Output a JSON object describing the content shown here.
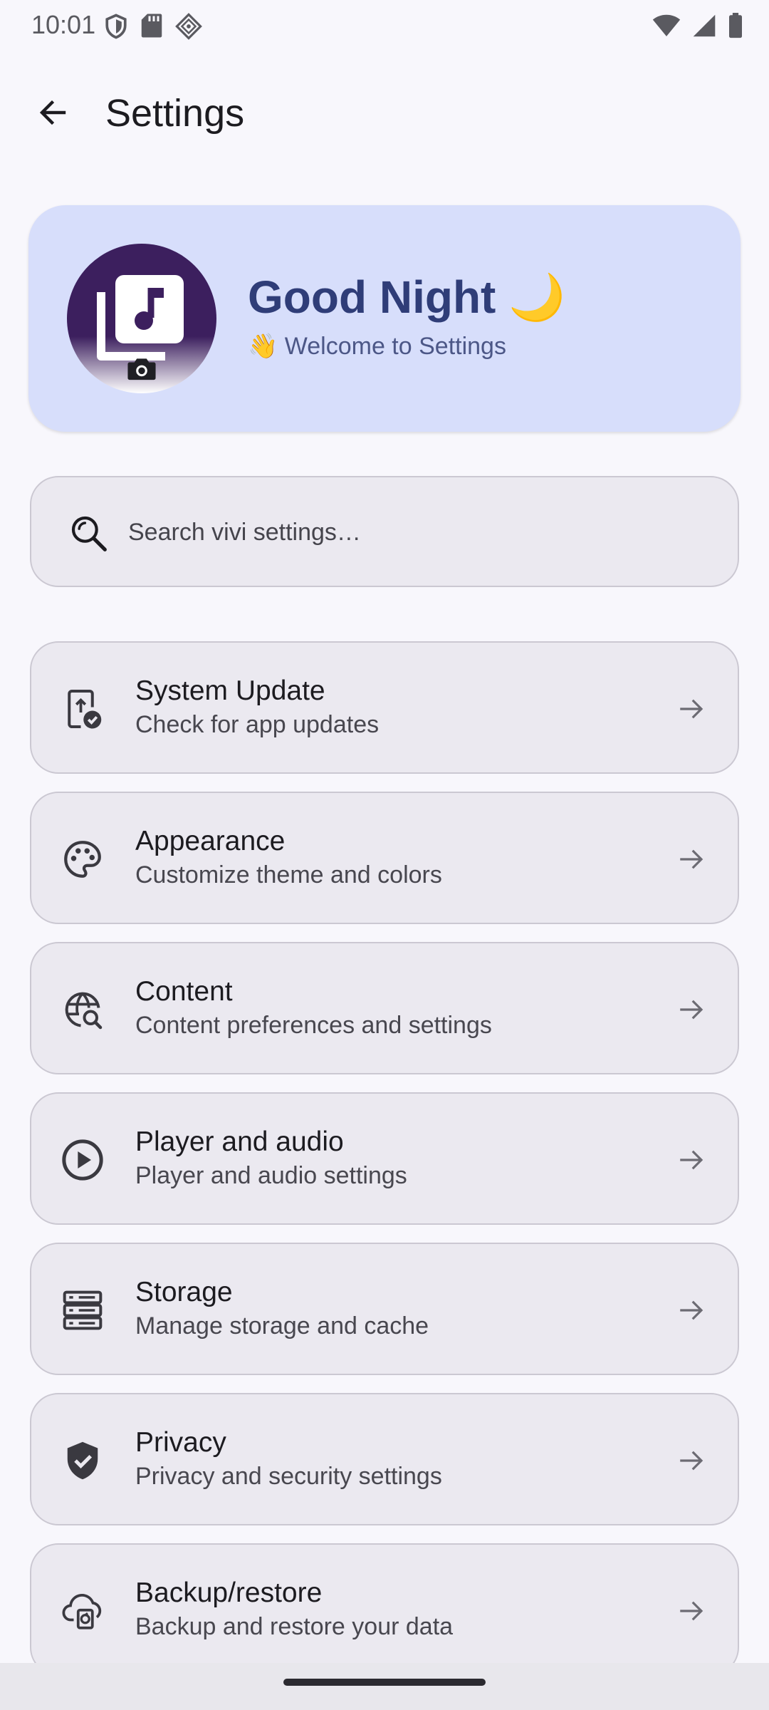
{
  "status_bar": {
    "time": "10:01",
    "icons": [
      "shield-icon",
      "sd-card-icon",
      "vpn-diamond-icon",
      "wifi-icon",
      "signal-icon",
      "battery-icon"
    ]
  },
  "app_bar": {
    "back_icon": "arrow-back-icon",
    "title": "Settings"
  },
  "welcome_card": {
    "greeting": "Good Night 🌙",
    "subtitle": "👋 Welcome to Settings",
    "background_color": "#d7defb"
  },
  "search": {
    "placeholder": "Search vivi settings…"
  },
  "settings": {
    "items": [
      {
        "icon": "system-update-icon",
        "title": "System Update",
        "subtitle": "Check for app updates"
      },
      {
        "icon": "palette-icon",
        "title": "Appearance",
        "subtitle": "Customize theme and colors"
      },
      {
        "icon": "globe-search-icon",
        "title": "Content",
        "subtitle": "Content preferences and settings"
      },
      {
        "icon": "play-circle-icon",
        "title": "Player and audio",
        "subtitle": "Player and audio settings"
      },
      {
        "icon": "storage-icon",
        "title": "Storage",
        "subtitle": "Manage storage and cache"
      },
      {
        "icon": "shield-check-icon",
        "title": "Privacy",
        "subtitle": "Privacy and security settings"
      },
      {
        "icon": "cloud-backup-icon",
        "title": "Backup/restore",
        "subtitle": "Backup and restore your data"
      }
    ]
  },
  "colors": {
    "background": "#f8f7fc",
    "card": "#ebe9f0",
    "accent_text": "#2f3d78"
  }
}
